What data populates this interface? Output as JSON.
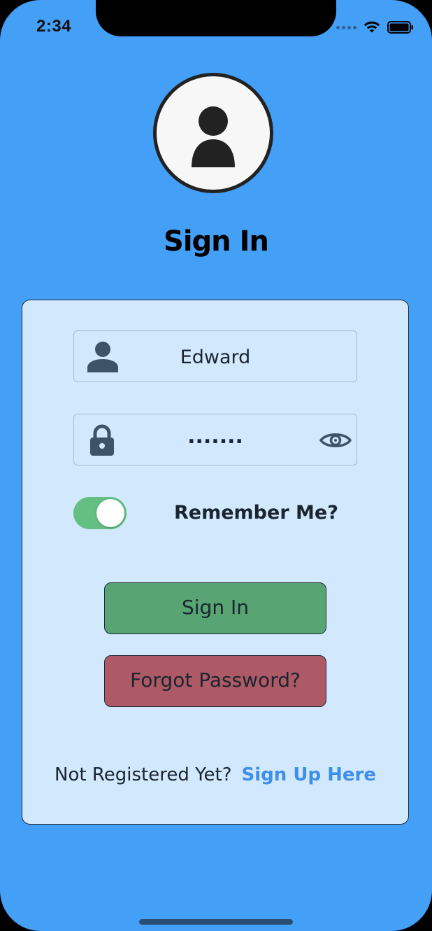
{
  "status_bar": {
    "time": "2:34"
  },
  "header": {
    "avatar_icon": "user-avatar-icon",
    "title": "Sign In"
  },
  "form": {
    "username": {
      "value": "Edward",
      "icon": "person-icon"
    },
    "password": {
      "value": ".......",
      "icon": "lock-icon",
      "toggle_icon": "eye-icon"
    },
    "remember_me": {
      "label": "Remember Me?",
      "checked": true
    },
    "sign_in_button": "Sign In",
    "forgot_button": "Forgot Password?",
    "footer": {
      "prompt": "Not Registered Yet?",
      "link": "Sign Up Here"
    }
  },
  "colors": {
    "background": "#449ff7",
    "card": "#d2e8fc",
    "sign_in": "#58a473",
    "forgot": "#ad5a66",
    "toggle_on": "#63c082",
    "link": "#3d8fe9"
  }
}
